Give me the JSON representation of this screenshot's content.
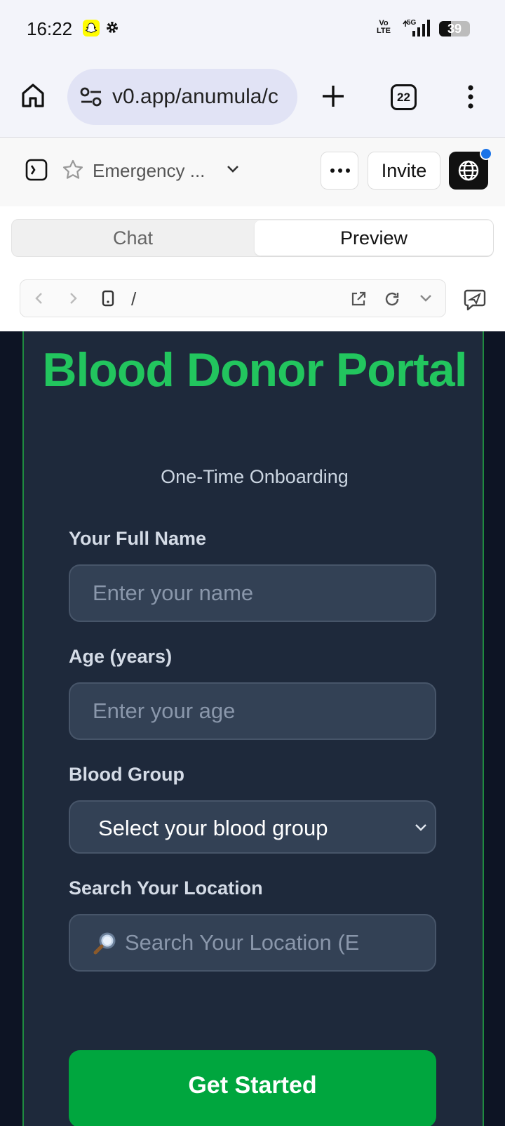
{
  "status_bar": {
    "time": "16:22",
    "network": "5G",
    "volte_label_top": "Vo",
    "volte_label_bottom": "LTE",
    "battery_percent": "39",
    "battery_level": 0.39
  },
  "browser": {
    "url": "v0.app/anumula/c",
    "tab_count": "22"
  },
  "app_header": {
    "project_name": "Emergency ...",
    "invite_label": "Invite"
  },
  "view_tabs": {
    "chat_label": "Chat",
    "preview_label": "Preview",
    "active": "Preview"
  },
  "preview_toolbar": {
    "path": "/"
  },
  "page": {
    "title": "Blood Donor Portal",
    "subtitle": "One-Time Onboarding",
    "name_label": "Your Full Name",
    "name_placeholder": "Enter your name",
    "age_label": "Age (years)",
    "age_placeholder": "Enter your age",
    "blood_label": "Blood Group",
    "blood_selected": "Select your blood group",
    "location_label": "Search Your Location",
    "location_placeholder": "Search Your Location (E",
    "cta_label": "Get Started"
  },
  "colors": {
    "accent_green": "#22c55e",
    "button_green": "#00a63e",
    "card_bg": "#1e293b",
    "field_bg": "#334155"
  }
}
